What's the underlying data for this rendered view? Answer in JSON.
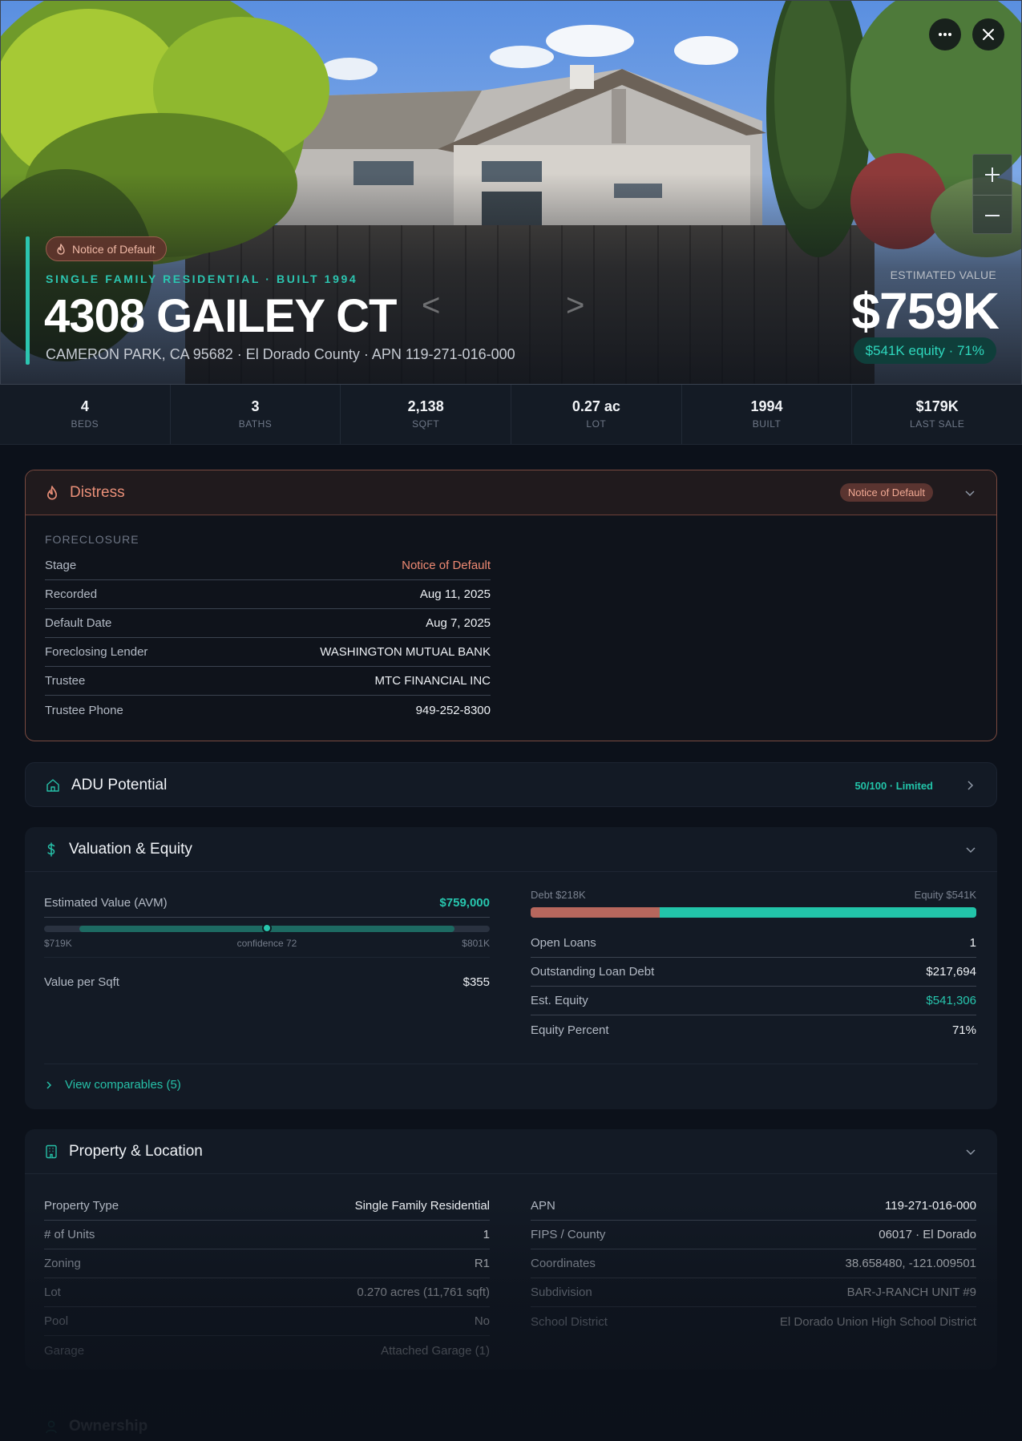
{
  "hero": {
    "badge": "Notice of Default",
    "subtitle": "SINGLE FAMILY RESIDENTIAL · BUILT 1994",
    "title": "4308 GAILEY CT",
    "address_line": "CAMERON PARK, CA 95682 · El Dorado County · APN 119-271-016-000",
    "est_label": "ESTIMATED VALUE",
    "est_value": "$759K",
    "equity_pill": "$541K equity · 71%"
  },
  "stats": [
    {
      "value": "4",
      "label": "BEDS"
    },
    {
      "value": "3",
      "label": "BATHS"
    },
    {
      "value": "2,138",
      "label": "SQFT"
    },
    {
      "value": "0.27 ac",
      "label": "LOT"
    },
    {
      "value": "1994",
      "label": "BUILT"
    },
    {
      "value": "$179K",
      "label": "LAST SALE"
    }
  ],
  "distress": {
    "title": "Distress",
    "pill": "Notice of Default",
    "section": "FORECLOSURE",
    "rows": [
      {
        "k": "Stage",
        "v": "Notice of Default"
      },
      {
        "k": "Recorded",
        "v": "Aug 11, 2025"
      },
      {
        "k": "Default Date",
        "v": "Aug 7, 2025"
      },
      {
        "k": "Foreclosing Lender",
        "v": "WASHINGTON MUTUAL BANK"
      },
      {
        "k": "Trustee",
        "v": "MTC FINANCIAL INC"
      },
      {
        "k": "Trustee Phone",
        "v": "949-252-8300"
      }
    ]
  },
  "adu": {
    "title": "ADU Potential",
    "score": "50/100 · Limited"
  },
  "valuation": {
    "title": "Valuation & Equity",
    "avm_label": "Estimated Value (AVM)",
    "avm_value": "$759,000",
    "range_low": "$719K",
    "range_mid": "confidence 72",
    "range_high": "$801K",
    "range_fill_start": 0.08,
    "range_fill_end": 0.92,
    "range_point": 0.5,
    "vps_label": "Value per Sqft",
    "vps_value": "$355",
    "debt_label": "Debt $218K",
    "equity_label": "Equity $541K",
    "debt_fraction": 0.29,
    "rows": [
      {
        "k": "Open Loans",
        "v": "1"
      },
      {
        "k": "Outstanding Loan Debt",
        "v": "$217,694"
      },
      {
        "k": "Est. Equity",
        "v": "$541,306"
      },
      {
        "k": "Equity Percent",
        "v": "71%"
      }
    ],
    "view_comps": "View comparables (5)"
  },
  "property": {
    "title": "Property & Location",
    "left": [
      {
        "k": "Property Type",
        "v": "Single Family Residential"
      },
      {
        "k": "# of Units",
        "v": "1"
      },
      {
        "k": "Zoning",
        "v": "R1"
      },
      {
        "k": "Lot",
        "v": "0.270 acres (11,761 sqft)"
      },
      {
        "k": "Pool",
        "v": "No"
      },
      {
        "k": "Garage",
        "v": "Attached Garage (1)"
      }
    ],
    "right": [
      {
        "k": "APN",
        "v": "119-271-016-000"
      },
      {
        "k": "FIPS / County",
        "v": "06017 · El Dorado"
      },
      {
        "k": "Coordinates",
        "v": "38.658480, -121.009501"
      },
      {
        "k": "Subdivision",
        "v": "BAR-J-RANCH UNIT #9"
      },
      {
        "k": "School District",
        "v": "El Dorado Union High School District"
      }
    ]
  },
  "ownership": {
    "title": "Ownership"
  },
  "colors": {
    "accent": "#2cc5b0",
    "distress": "#e98f78",
    "background": "#0c111a"
  }
}
